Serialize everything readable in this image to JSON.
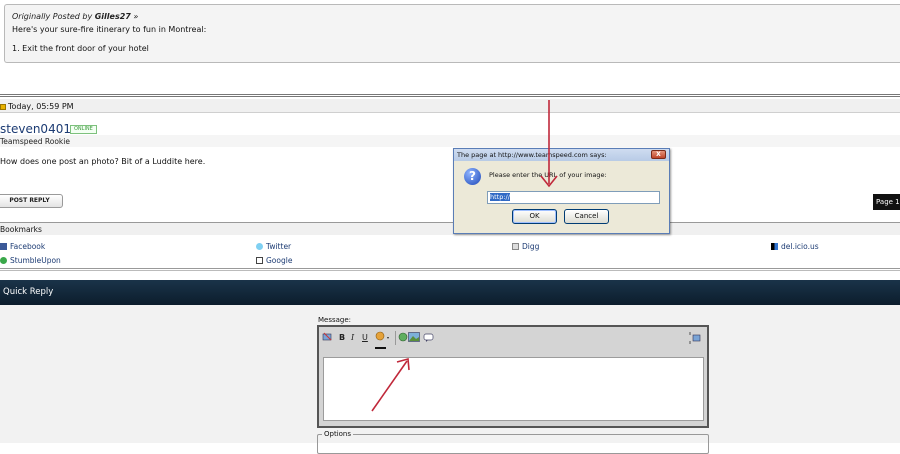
{
  "quote": {
    "posted_prefix": "Originally Posted by",
    "author": "Gilles27",
    "view_glyph": "»",
    "line1": "Here's your sure-fire itinerary to fun in Montreal:",
    "line2": "1. Exit the front door of your hotel"
  },
  "post": {
    "timestamp": "Today, 05:59 PM",
    "username": "steven0401",
    "status": "ONLINE",
    "user_title": "Teamspeed Rookie",
    "message": "How does one post an photo? Bit of a Luddite here.",
    "post_reply_label": "POST REPLY",
    "page_label": "Page 1"
  },
  "bookmarks": {
    "title": "Bookmarks",
    "items": [
      {
        "label": "Facebook",
        "icon": "facebook-icon"
      },
      {
        "label": "Twitter",
        "icon": "twitter-icon"
      },
      {
        "label": "Digg",
        "icon": "digg-icon"
      },
      {
        "label": "del.icio.us",
        "icon": "delicious-icon"
      },
      {
        "label": "StumbleUpon",
        "icon": "stumbleupon-icon"
      },
      {
        "label": "Google",
        "icon": "google-icon"
      }
    ]
  },
  "quick_reply": {
    "title": "Quick Reply",
    "message_label": "Message:",
    "options_label": "Options",
    "toolbar": {
      "bold": "B",
      "italic": "I",
      "underline": "U"
    }
  },
  "dialog": {
    "title": "The page at http://www.teamspeed.com says:",
    "close_glyph": "X",
    "message": "Please enter the URL of your image:",
    "input_value": "http://",
    "ok_label": "OK",
    "cancel_label": "Cancel"
  },
  "colors": {
    "quick_reply_bar": "#12263a",
    "annotation_arrow": "#c0283a",
    "link": "#1c3b73"
  }
}
